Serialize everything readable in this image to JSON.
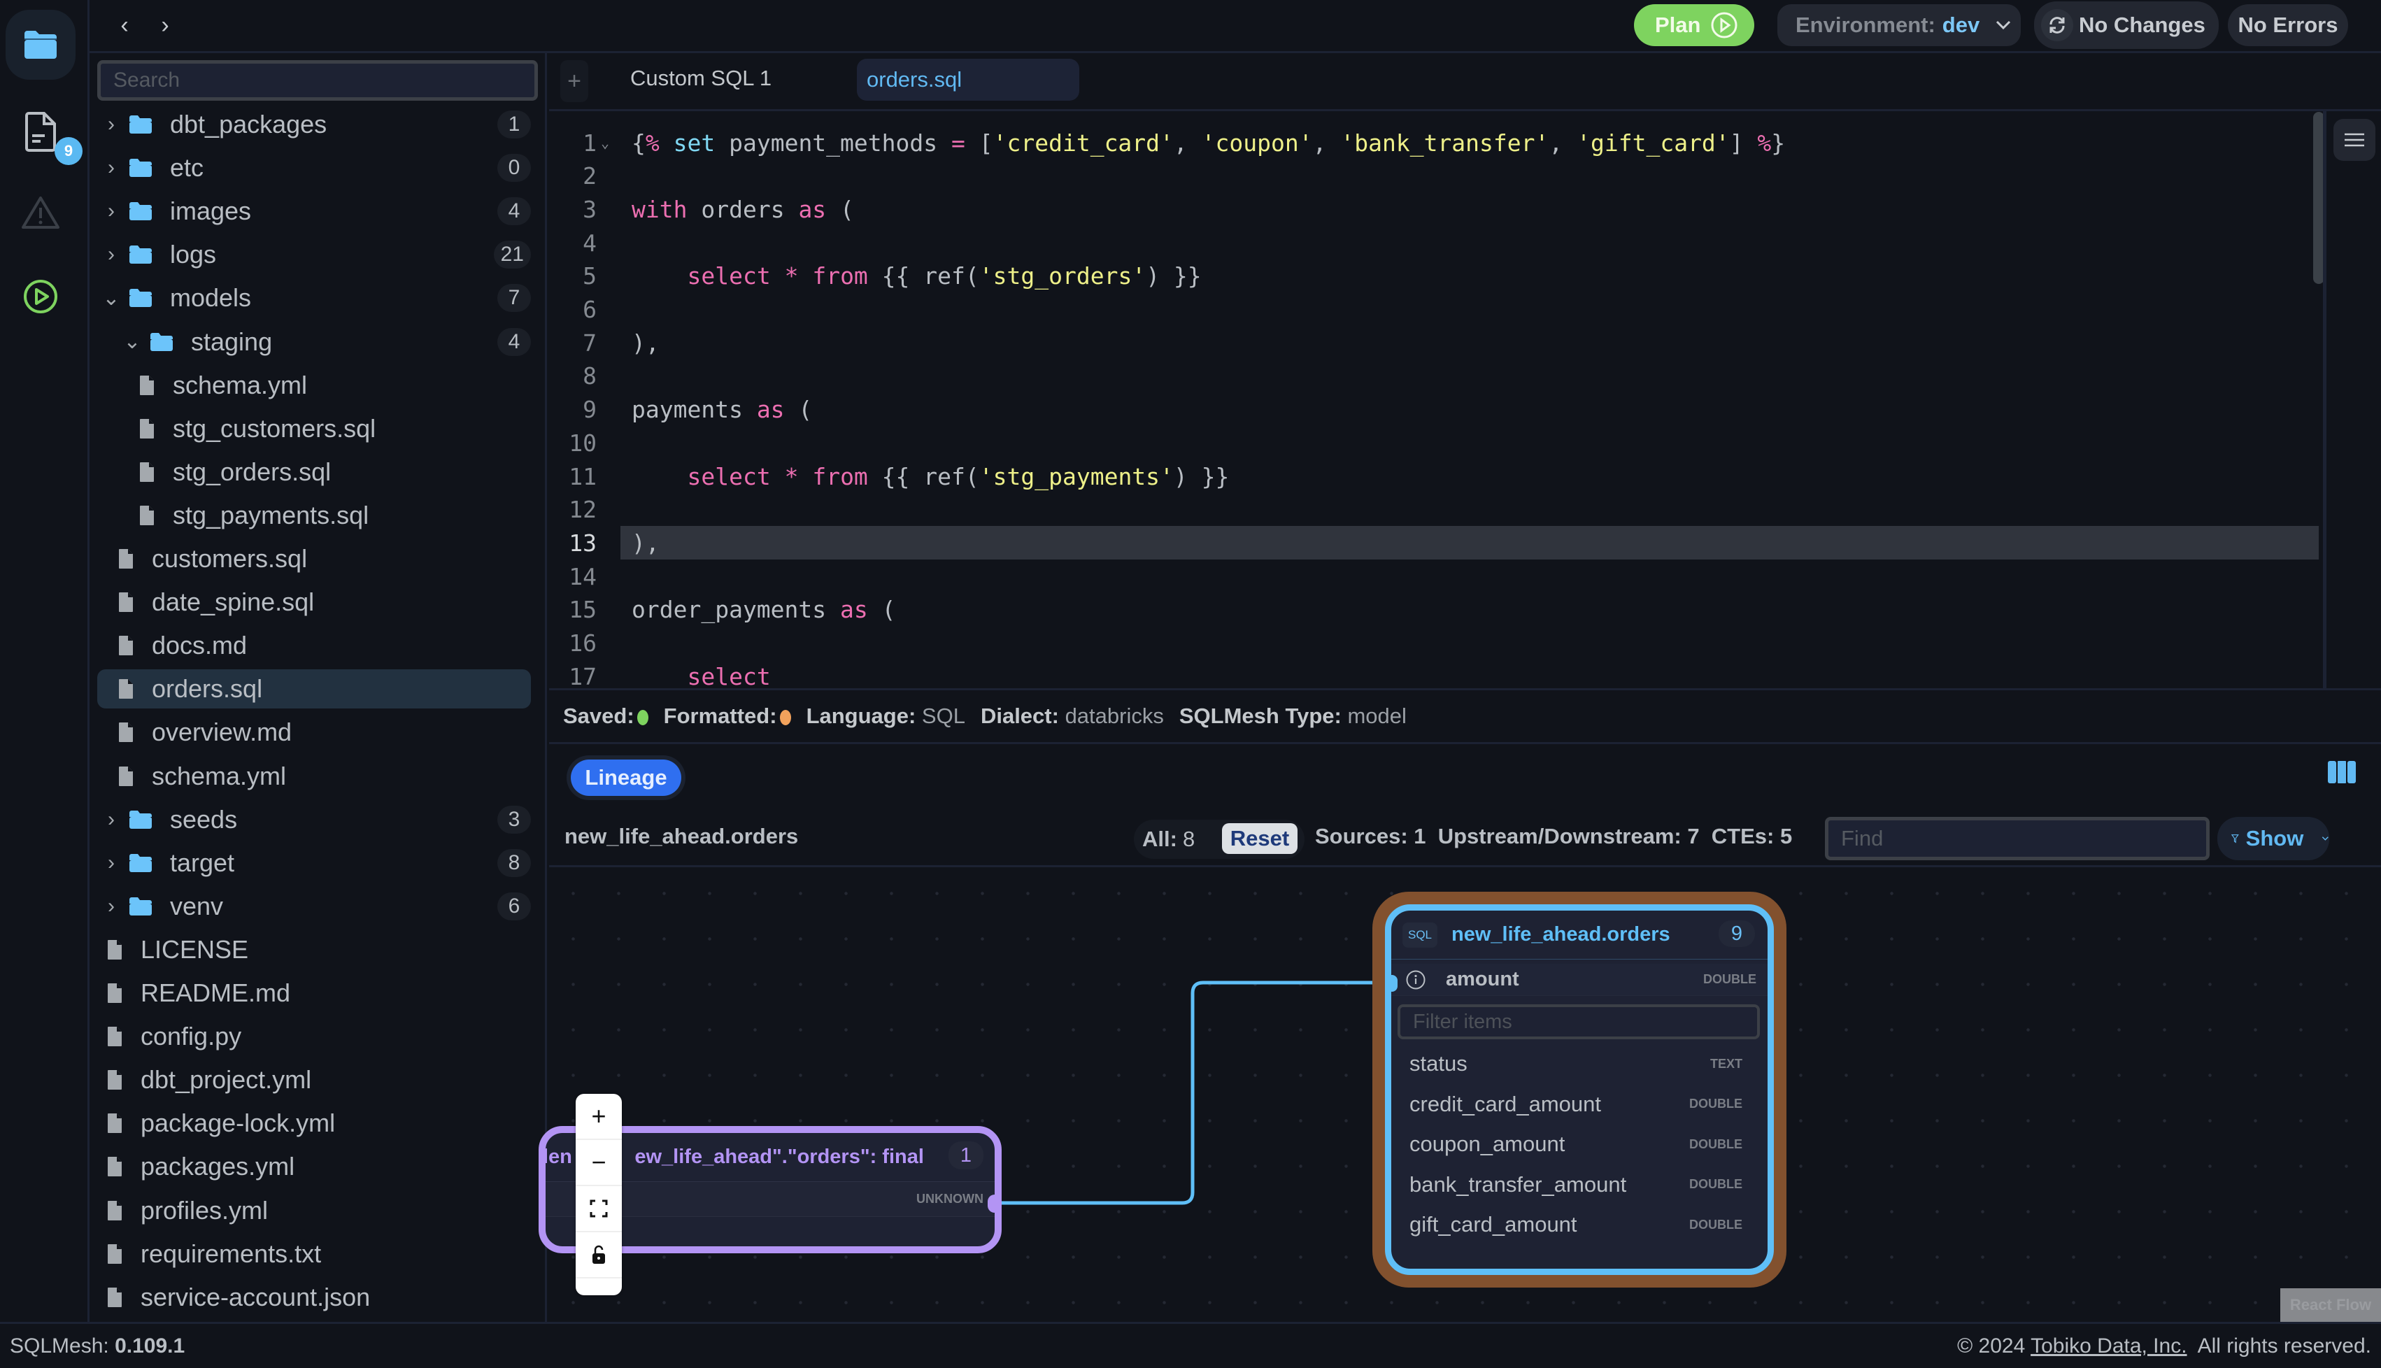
{
  "activity": {
    "files_badge": "9"
  },
  "topbar": {
    "plan_label": "Plan",
    "environment_label": "Environment:",
    "environment_value": "dev",
    "changes_label": "No Changes",
    "errors_label": "No Errors"
  },
  "sidebar": {
    "search_placeholder": "Search",
    "items": [
      {
        "type": "folder",
        "label": "dbt_packages",
        "count": "1",
        "expanded": false,
        "depth": 0
      },
      {
        "type": "folder",
        "label": "etc",
        "count": "0",
        "expanded": false,
        "depth": 0
      },
      {
        "type": "folder",
        "label": "images",
        "count": "4",
        "expanded": false,
        "depth": 0
      },
      {
        "type": "folder",
        "label": "logs",
        "count": "21",
        "expanded": false,
        "depth": 0
      },
      {
        "type": "folder",
        "label": "models",
        "count": "7",
        "expanded": true,
        "depth": 0
      },
      {
        "type": "folder",
        "label": "staging",
        "count": "4",
        "expanded": true,
        "depth": 1
      },
      {
        "type": "file",
        "label": "schema.yml",
        "depth": 2
      },
      {
        "type": "file",
        "label": "stg_customers.sql",
        "depth": 2
      },
      {
        "type": "file",
        "label": "stg_orders.sql",
        "depth": 2
      },
      {
        "type": "file",
        "label": "stg_payments.sql",
        "depth": 2
      },
      {
        "type": "file",
        "label": "customers.sql",
        "depth": 1
      },
      {
        "type": "file",
        "label": "date_spine.sql",
        "depth": 1
      },
      {
        "type": "file",
        "label": "docs.md",
        "depth": 1
      },
      {
        "type": "file",
        "label": "orders.sql",
        "depth": 1,
        "selected": true
      },
      {
        "type": "file",
        "label": "overview.md",
        "depth": 1
      },
      {
        "type": "file",
        "label": "schema.yml",
        "depth": 1
      },
      {
        "type": "folder",
        "label": "seeds",
        "count": "3",
        "expanded": false,
        "depth": 0
      },
      {
        "type": "folder",
        "label": "target",
        "count": "8",
        "expanded": false,
        "depth": 0
      },
      {
        "type": "folder",
        "label": "venv",
        "count": "6",
        "expanded": false,
        "depth": 0
      },
      {
        "type": "file",
        "label": "LICENSE",
        "depth": 0
      },
      {
        "type": "file",
        "label": "README.md",
        "depth": 0
      },
      {
        "type": "file",
        "label": "config.py",
        "depth": 0
      },
      {
        "type": "file",
        "label": "dbt_project.yml",
        "depth": 0
      },
      {
        "type": "file",
        "label": "package-lock.yml",
        "depth": 0
      },
      {
        "type": "file",
        "label": "packages.yml",
        "depth": 0
      },
      {
        "type": "file",
        "label": "profiles.yml",
        "depth": 0
      },
      {
        "type": "file",
        "label": "requirements.txt",
        "depth": 0
      },
      {
        "type": "file",
        "label": "service-account.json",
        "depth": 0
      }
    ]
  },
  "editor": {
    "tabs": [
      {
        "label": "Custom SQL 1",
        "active": false
      },
      {
        "label": "orders.sql",
        "active": true
      }
    ],
    "current_line": 13,
    "lines": [
      [
        [
          "p",
          "{"
        ],
        [
          "k",
          "%"
        ],
        [
          "c",
          " set"
        ],
        [
          "p",
          " payment_methods "
        ],
        [
          "k",
          "="
        ],
        [
          "p",
          " ["
        ],
        [
          "s",
          "'credit_card'"
        ],
        [
          "p",
          ", "
        ],
        [
          "s",
          "'coupon'"
        ],
        [
          "p",
          ", "
        ],
        [
          "s",
          "'bank_transfer'"
        ],
        [
          "p",
          ", "
        ],
        [
          "s",
          "'gift_card'"
        ],
        [
          "p",
          "] "
        ],
        [
          "k",
          "%"
        ],
        [
          "p",
          "}"
        ]
      ],
      [],
      [
        [
          "k",
          "with"
        ],
        [
          "p",
          " orders "
        ],
        [
          "k",
          "as"
        ],
        [
          "p",
          " ("
        ]
      ],
      [],
      [
        [
          "p",
          "    "
        ],
        [
          "k",
          "select"
        ],
        [
          "p",
          " "
        ],
        [
          "k",
          "*"
        ],
        [
          "p",
          " "
        ],
        [
          "k",
          "from"
        ],
        [
          "p",
          " {{ ref("
        ],
        [
          "s",
          "'stg_orders'"
        ],
        [
          "p",
          ") }}"
        ]
      ],
      [],
      [
        [
          "p",
          "),"
        ]
      ],
      [],
      [
        [
          "p",
          "payments "
        ],
        [
          "k",
          "as"
        ],
        [
          "p",
          " ("
        ]
      ],
      [],
      [
        [
          "p",
          "    "
        ],
        [
          "k",
          "select"
        ],
        [
          "p",
          " "
        ],
        [
          "k",
          "*"
        ],
        [
          "p",
          " "
        ],
        [
          "k",
          "from"
        ],
        [
          "p",
          " {{ ref("
        ],
        [
          "s",
          "'stg_payments'"
        ],
        [
          "p",
          ") }}"
        ]
      ],
      [],
      [
        [
          "p",
          "),"
        ]
      ],
      [],
      [
        [
          "p",
          "order_payments "
        ],
        [
          "k",
          "as"
        ],
        [
          "p",
          " ("
        ]
      ],
      [],
      [
        [
          "p",
          "    "
        ],
        [
          "k",
          "select"
        ]
      ]
    ]
  },
  "status": {
    "saved_label": "Saved:",
    "saved_color": "#7ed35f",
    "formatted_label": "Formatted:",
    "formatted_color": "#f2a25c",
    "language_label": "Language:",
    "language_value": "SQL",
    "dialect_label": "Dialect:",
    "dialect_value": "databricks",
    "type_label": "SQLMesh Type:",
    "type_value": "model"
  },
  "lineage": {
    "tab_label": "Lineage",
    "model_name": "new_life_ahead.orders",
    "all_label": "All:",
    "all_value": "8",
    "reset_label": "Reset",
    "stats": "Sources: 1  Upstream/Downstream: 7  CTEs: 5",
    "find_placeholder": "Find",
    "show_label": "Show",
    "main_node": {
      "kind": "SQL",
      "title": "new_life_ahead.orders",
      "count": "9",
      "active_column": {
        "name": "amount",
        "type": "DOUBLE"
      },
      "filter_placeholder": "Filter items",
      "columns": [
        {
          "name": "status",
          "type": "TEXT"
        },
        {
          "name": "credit_card_amount",
          "type": "DOUBLE"
        },
        {
          "name": "coupon_amount",
          "type": "DOUBLE"
        },
        {
          "name": "bank_transfer_amount",
          "type": "DOUBLE"
        },
        {
          "name": "gift_card_amount",
          "type": "DOUBLE"
        }
      ]
    },
    "source_node": {
      "title": "\"new_life_ahead\".\"orders\": final",
      "title_prefix": "len",
      "count": "1",
      "column_type": "UNKNOWN"
    },
    "attribution": "React Flow"
  },
  "footer": {
    "version_label": "SQLMesh:",
    "version_value": "0.109.1",
    "copyright_prefix": "© 2024",
    "company": "Tobiko Data, Inc.",
    "rights": "All rights reserved."
  }
}
